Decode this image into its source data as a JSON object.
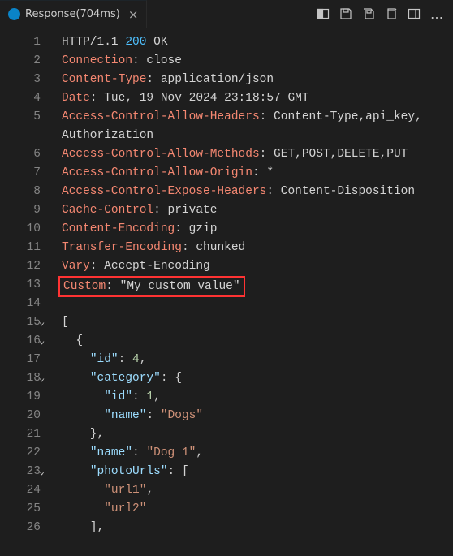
{
  "tab": {
    "title": "Response(704ms)"
  },
  "gutter": {
    "numbers": [
      "1",
      "2",
      "3",
      "4",
      "5",
      "6",
      "7",
      "8",
      "9",
      "10",
      "11",
      "12",
      "13",
      "14",
      "15",
      "16",
      "17",
      "18",
      "19",
      "20",
      "21",
      "22",
      "23",
      "24",
      "25",
      "26"
    ]
  },
  "http": {
    "proto": "HTTP/1.1",
    "code": "200",
    "reason": "OK",
    "colon": ":"
  },
  "hdrs": {
    "connection_k": "Connection",
    "connection_v": "close",
    "content_type_k": "Content-Type",
    "content_type_v": "application/json",
    "date_k": "Date",
    "date_v": "Tue, 19 Nov 2024 23:18:57 GMT",
    "acah_k": "Access-Control-Allow-Headers",
    "acah_v": "Content-Type,api_key,",
    "acah_v2": "Authorization",
    "acam_k": "Access-Control-Allow-Methods",
    "acam_v": "GET,POST,DELETE,PUT",
    "acao_k": "Access-Control-Allow-Origin",
    "acao_v": "*",
    "aceh_k": "Access-Control-Expose-Headers",
    "aceh_v": "Content-Disposition",
    "cache_k": "Cache-Control",
    "cache_v": "private",
    "cenc_k": "Content-Encoding",
    "cenc_v": "gzip",
    "tenc_k": "Transfer-Encoding",
    "tenc_v": "chunked",
    "vary_k": "Vary",
    "vary_v": "Accept-Encoding",
    "custom_k": "Custom",
    "custom_v": "\"My custom value\""
  },
  "body": {
    "arr_open": "[",
    "obj_open": "{",
    "obj_close": "}",
    "obj_close_comma": "},",
    "arr_open_bracket": "[",
    "arr_close": "],",
    "id_k": "\"id\"",
    "id_v": "4",
    "cat_k": "\"category\"",
    "cat_id_k": "\"id\"",
    "cat_id_v": "1",
    "cat_name_k": "\"name\"",
    "cat_name_v": "\"Dogs\"",
    "name_k": "\"name\"",
    "name_v": "\"Dog 1\"",
    "photo_k": "\"photoUrls\"",
    "url1": "\"url1\"",
    "url2": "\"url2\"",
    "comma": ","
  }
}
